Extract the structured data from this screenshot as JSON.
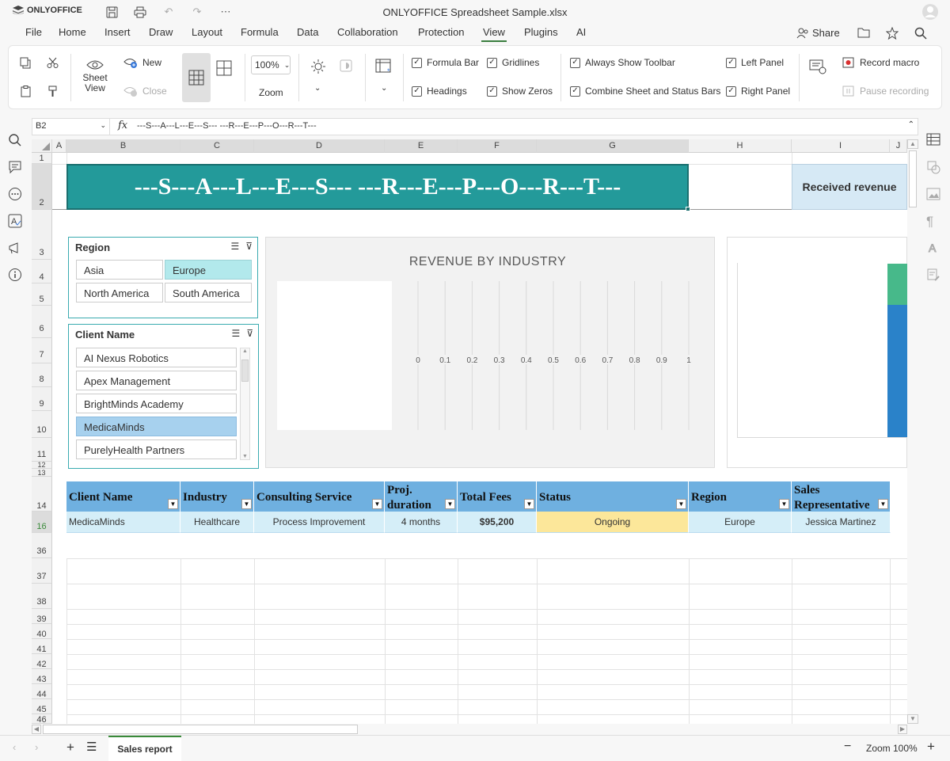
{
  "app": {
    "brand": "ONLYOFFICE",
    "title": "ONLYOFFICE Spreadsheet Sample.xlsx"
  },
  "menu": [
    "File",
    "Home",
    "Insert",
    "Draw",
    "Layout",
    "Formula",
    "Data",
    "Collaboration",
    "Protection",
    "View",
    "Plugins",
    "AI"
  ],
  "menu_active": "View",
  "share_label": "Share",
  "ribbon": {
    "sheet_view": "Sheet View",
    "new": "New",
    "close": "Close",
    "zoom_value": "100%",
    "zoom_label": "Zoom",
    "formula_bar": "Formula Bar",
    "headings": "Headings",
    "gridlines": "Gridlines",
    "show_zeros": "Show Zeros",
    "always_show_toolbar": "Always Show Toolbar",
    "combine_bars": "Combine Sheet and Status Bars",
    "left_panel": "Left Panel",
    "right_panel": "Right Panel",
    "record_macro": "Record macro",
    "pause_recording": "Pause recording"
  },
  "formula_bar": {
    "cell": "B2",
    "fx": "fx",
    "content": "---S---A---L---E---S--- ---R---E---P---O---R---T---"
  },
  "columns": [
    "A",
    "B",
    "C",
    "D",
    "E",
    "F",
    "G",
    "H",
    "I",
    "J"
  ],
  "rows": [
    "1",
    "2",
    "3",
    "4",
    "5",
    "6",
    "7",
    "8",
    "9",
    "10",
    "11",
    "12",
    "13",
    "14",
    "16",
    "36",
    "37",
    "38",
    "39",
    "40",
    "41",
    "42",
    "43",
    "44",
    "45",
    "46"
  ],
  "banner": "---S---A---L---E---S--- ---R---E---P---O---R---T---",
  "received_revenue": "Received revenue",
  "slicer_region": {
    "title": "Region",
    "items": [
      "Asia",
      "Europe",
      "North America",
      "South America"
    ],
    "selected": "Europe"
  },
  "slicer_client": {
    "title": "Client Name",
    "items": [
      "AI Nexus Robotics",
      "Apex Management",
      "BrightMinds Academy",
      "MedicaMinds",
      "PurelyHealth Partners"
    ],
    "selected": "MedicaMinds"
  },
  "chart_data": {
    "type": "bar",
    "title": "REVENUE BY INDUSTRY",
    "categories": [],
    "values": [],
    "xlim": [
      0,
      1
    ],
    "ticks": [
      "0",
      "0.1",
      "0.2",
      "0.3",
      "0.4",
      "0.5",
      "0.6",
      "0.7",
      "0.8",
      "0.9",
      "1"
    ],
    "grid": true
  },
  "table": {
    "headers": [
      "Client Name",
      "Industry",
      "Consulting Service",
      "Proj. duration",
      "Total Fees",
      "Status",
      "Region",
      "Sales Representative"
    ],
    "row": [
      "MedicaMinds",
      "Healthcare",
      "Process Improvement",
      "4 months",
      "$95,200",
      "Ongoing",
      "Europe",
      "Jessica Martinez"
    ]
  },
  "sheet_tab": "Sales report",
  "zoom_status": "Zoom 100%",
  "colors": {
    "banner": "#239a9a",
    "accent": "#3a7e3f",
    "header": "#6fb0e0",
    "status_ongoing": "#fce79a"
  }
}
